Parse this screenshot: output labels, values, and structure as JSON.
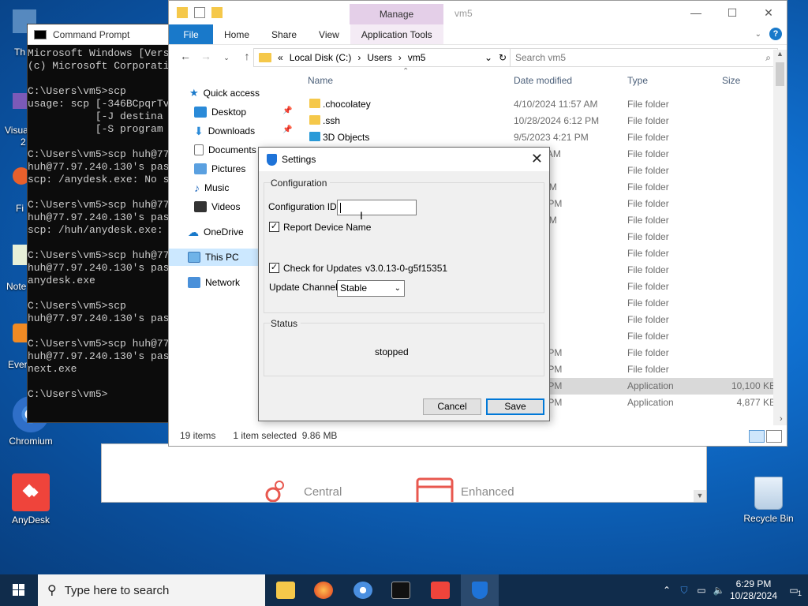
{
  "desktop": {
    "icons": [
      {
        "label": "Chromium"
      },
      {
        "label": "AnyDesk"
      },
      {
        "label": "Recycle Bin"
      }
    ],
    "cut_labels": [
      "Th",
      "Visua",
      "2",
      "Fi",
      "Note",
      "Ever"
    ]
  },
  "cmd": {
    "title": "Command Prompt",
    "lines": [
      "Microsoft Windows [Vers",
      "(c) Microsoft Corporati",
      "",
      "C:\\Users\\vm5>scp",
      "usage: scp [-346BCpqrTv",
      "           [-J destina",
      "           [-S program",
      "",
      "C:\\Users\\vm5>scp huh@77",
      "huh@77.97.240.130's pas",
      "scp: /anydesk.exe: No s",
      "",
      "C:\\Users\\vm5>scp huh@77",
      "huh@77.97.240.130's pas",
      "scp: /huh/anydesk.exe: ",
      "",
      "C:\\Users\\vm5>scp huh@77",
      "huh@77.97.240.130's pas",
      "anydesk.exe",
      "",
      "C:\\Users\\vm5>scp",
      "huh@77.97.240.130's pas",
      "",
      "C:\\Users\\vm5>scp huh@77",
      "huh@77.97.240.130's pas",
      "next.exe",
      "",
      "C:\\Users\\vm5>"
    ]
  },
  "explorer": {
    "window_title": "vm5",
    "manage_tab": "Manage",
    "ribbon_tabs": [
      "File",
      "Home",
      "Share",
      "View",
      "Application Tools"
    ],
    "path": [
      "Local Disk (C:)",
      "Users",
      "vm5"
    ],
    "search_placeholder": "Search vm5",
    "nav": {
      "quick_access": "Quick access",
      "desktop": "Desktop",
      "downloads": "Downloads",
      "documents": "Documents",
      "pictures": "Pictures",
      "music": "Music",
      "videos": "Videos",
      "onedrive": "OneDrive",
      "this_pc": "This PC",
      "network": "Network"
    },
    "columns": {
      "name": "Name",
      "date": "Date modified",
      "type": "Type",
      "size": "Size"
    },
    "rows": [
      {
        "name": ".chocolatey",
        "date": "4/10/2024 11:57 AM",
        "type": "File folder",
        "size": ""
      },
      {
        "name": ".ssh",
        "date": "10/28/2024 6:12 PM",
        "type": "File folder",
        "size": ""
      },
      {
        "name": "3D Objects",
        "date": "9/5/2023 4:21 PM",
        "type": "File folder",
        "size": ""
      },
      {
        "name": "",
        "date": "4 11:56 AM",
        "type": "File folder",
        "size": ""
      },
      {
        "name": "",
        "date": "4:21 PM",
        "type": "File folder",
        "size": ""
      },
      {
        "name": "",
        "date": "4 3:55 PM",
        "type": "File folder",
        "size": ""
      },
      {
        "name": "",
        "date": "4 12:15 PM",
        "type": "File folder",
        "size": ""
      },
      {
        "name": "",
        "date": "4 3:59 PM",
        "type": "File folder",
        "size": ""
      },
      {
        "name": "",
        "date": "4:21 PM",
        "type": "File folder",
        "size": ""
      },
      {
        "name": "",
        "date": "4:21 PM",
        "type": "File folder",
        "size": ""
      },
      {
        "name": "",
        "date": "4:21 PM",
        "type": "File folder",
        "size": ""
      },
      {
        "name": "",
        "date": "4:23 PM",
        "type": "File folder",
        "size": ""
      },
      {
        "name": "",
        "date": "4:21 PM",
        "type": "File folder",
        "size": ""
      },
      {
        "name": "",
        "date": "4:21 PM",
        "type": "File folder",
        "size": ""
      },
      {
        "name": "",
        "date": "4:21 PM",
        "type": "File folder",
        "size": ""
      },
      {
        "name": "",
        "date": "4 12:16 PM",
        "type": "File folder",
        "size": ""
      },
      {
        "name": "",
        "date": "24 6:10 PM",
        "type": "File folder",
        "size": ""
      },
      {
        "name": "",
        "date": "24 6:28 PM",
        "type": "Application",
        "size": "10,100 KB"
      },
      {
        "name": "",
        "date": "24 6:23 PM",
        "type": "Application",
        "size": "4,877 KB"
      }
    ],
    "status": {
      "items": "19 items",
      "selected": "1 item selected",
      "size": "9.86 MB"
    }
  },
  "anydesk_bg": {
    "feature1": "Central",
    "feature2": "Enhanced"
  },
  "settings": {
    "title": "Settings",
    "configuration_group": "Configuration",
    "config_id_label": "Configuration ID:",
    "config_id_value": "",
    "report_device_name": "Report Device Name",
    "check_for_updates": "Check for Updates",
    "version": "v3.0.13-0-g5f15351",
    "update_channel_label": "Update Channel:",
    "update_channel_value": "Stable",
    "status_group": "Status",
    "status_value": "stopped",
    "cancel": "Cancel",
    "save": "Save"
  },
  "taskbar": {
    "search_placeholder": "Type here to search",
    "time": "6:29 PM",
    "date": "10/28/2024",
    "notifications": "1"
  }
}
